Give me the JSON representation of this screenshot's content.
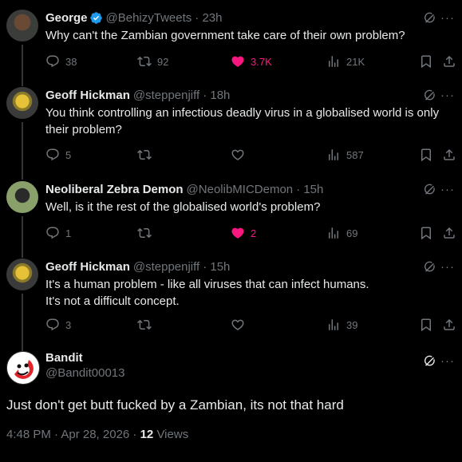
{
  "replies": [
    {
      "name": "George",
      "handle": "@BehizyTweets",
      "time": "· 23h",
      "verified": true,
      "text": "Why can't the Zambian government take care of their own problem?",
      "replies": "38",
      "reposts": "92",
      "likes": "3.7K",
      "liked": true,
      "views": "21K"
    },
    {
      "name": "Geoff Hickman",
      "handle": "@steppenjiff",
      "time": "· 18h",
      "verified": false,
      "text": "You think controlling an infectious deadly virus in a globalised world is only their problem?",
      "replies": "5",
      "reposts": "",
      "likes": "",
      "liked": false,
      "views": "587"
    },
    {
      "name": "Neoliberal Zebra Demon",
      "handle": "@NeolibMICDemon",
      "time": "· 15h",
      "verified": false,
      "text": "Well, is it the rest of the globalised world's problem?",
      "replies": "1",
      "reposts": "",
      "likes": "2",
      "liked": true,
      "views": "69"
    },
    {
      "name": "Geoff Hickman",
      "handle": "@steppenjiff",
      "time": "· 15h",
      "verified": false,
      "text_line1": "It's a human problem - like all viruses that can infect humans.",
      "text_line2": "It's not a difficult concept.",
      "replies": "3",
      "reposts": "",
      "likes": "",
      "liked": false,
      "views": "39"
    }
  ],
  "main": {
    "name": "Bandit",
    "handle": "@Bandit00013",
    "text": "Just don't get butt fucked by a Zambian, its not that hard",
    "timestamp": "4:48 PM · Apr 28, 2026 · ",
    "views_count": "12",
    "views_label": "Views"
  },
  "colors": {
    "background": "#000000",
    "text": "#e7e9ea",
    "muted": "#71767b",
    "like": "#f91880",
    "verified": "#1d9bf0"
  },
  "icons": [
    "reply-icon",
    "repost-icon",
    "like-icon",
    "views-icon",
    "bookmark-icon",
    "share-icon",
    "grok-icon",
    "more-icon",
    "verified-badge-icon"
  ]
}
